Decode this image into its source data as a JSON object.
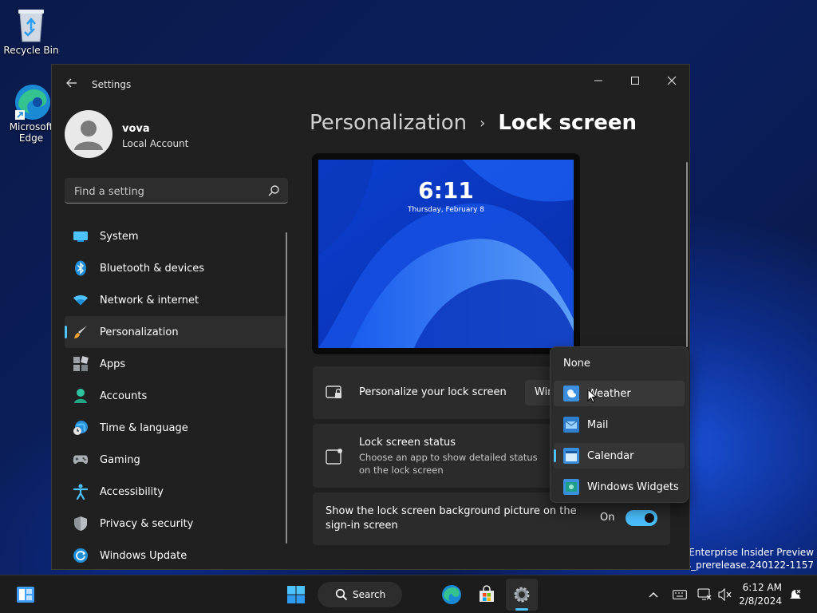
{
  "desktop": {
    "icons": [
      {
        "label": "Recycle Bin"
      },
      {
        "label": "Microsoft Edge"
      }
    ],
    "watermark_line1": "s 11 Enterprise Insider Preview",
    "watermark_line2": "040.rs_prerelease.240122-1157"
  },
  "window": {
    "title": "Settings",
    "profile": {
      "name": "vova",
      "account_type": "Local Account"
    },
    "search": {
      "placeholder": "Find a setting"
    },
    "nav": [
      {
        "label": "System",
        "icon": "system-icon"
      },
      {
        "label": "Bluetooth & devices",
        "icon": "bluetooth-icon"
      },
      {
        "label": "Network & internet",
        "icon": "wifi-icon"
      },
      {
        "label": "Personalization",
        "icon": "paintbrush-icon",
        "active": true
      },
      {
        "label": "Apps",
        "icon": "apps-icon"
      },
      {
        "label": "Accounts",
        "icon": "person-icon"
      },
      {
        "label": "Time & language",
        "icon": "globe-clock-icon"
      },
      {
        "label": "Gaming",
        "icon": "gamepad-icon"
      },
      {
        "label": "Accessibility",
        "icon": "accessibility-icon"
      },
      {
        "label": "Privacy & security",
        "icon": "shield-icon"
      },
      {
        "label": "Windows Update",
        "icon": "update-icon"
      }
    ],
    "breadcrumb": {
      "parent": "Personalization",
      "current": "Lock screen"
    },
    "preview": {
      "time": "6:11",
      "date": "Thursday, February 8"
    },
    "cards": {
      "personalize": {
        "title": "Personalize your lock screen",
        "value_partial": "Wir"
      },
      "status": {
        "title": "Lock screen status",
        "subtitle_line1": "Choose an app to show detailed status",
        "subtitle_line2": "on the lock screen"
      },
      "signin": {
        "title_line1": "Show the lock screen background picture on the",
        "title_line2": "sign-in screen",
        "state": "On"
      }
    },
    "dropdown": {
      "options": [
        {
          "label": "None"
        },
        {
          "label": "Weather",
          "hover": true
        },
        {
          "label": "Mail"
        },
        {
          "label": "Calendar",
          "selected": true
        },
        {
          "label": "Windows Widgets"
        }
      ]
    }
  },
  "taskbar": {
    "search_label": "Search",
    "time": "6:12 AM",
    "date": "2/8/2024"
  },
  "colors": {
    "accent": "#4cc2ff",
    "window_bg": "#202020",
    "card_bg": "#2b2b2b"
  }
}
